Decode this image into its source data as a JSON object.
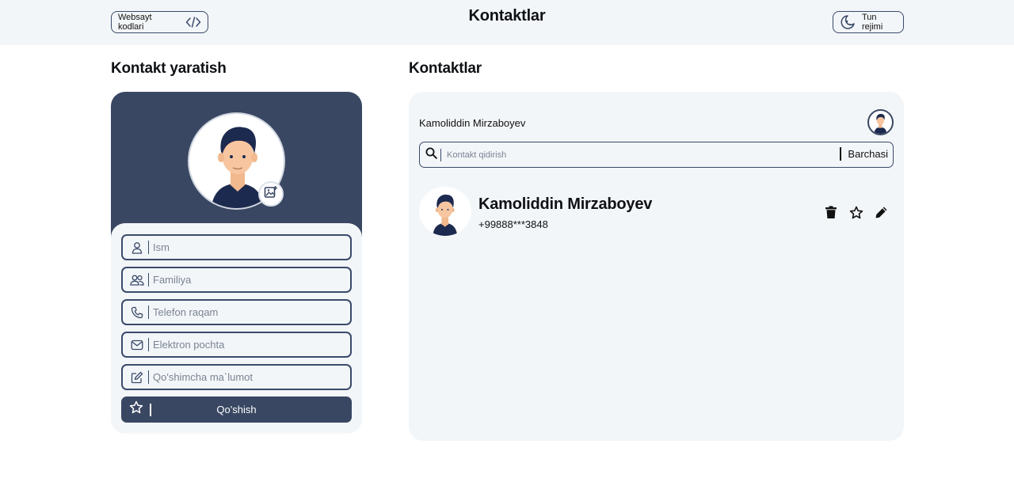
{
  "header": {
    "code_button_label": "Websayt kodlari",
    "title": "Kontaktlar",
    "theme_button_label": "Tun rejimi"
  },
  "create": {
    "title": "Kontakt yaratish",
    "fields": {
      "first_name_placeholder": "Ism",
      "last_name_placeholder": "Familiya",
      "phone_placeholder": "Telefon raqam",
      "email_placeholder": "Elektron pochta",
      "note_placeholder": "Qo'shimcha ma`lumot"
    },
    "submit_label": "Qo'shish"
  },
  "contacts": {
    "title": "Kontaktlar",
    "current_user": "Kamoliddin Mirzaboyev",
    "search_placeholder": "Kontakt qidirish",
    "filter_label": "Barchasi",
    "items": [
      {
        "name": "Kamoliddin Mirzaboyev",
        "phone": "+99888***3848"
      }
    ]
  },
  "colors": {
    "accent": "#394763",
    "surface": "#f3f6f8"
  },
  "icons": [
    "code-icon",
    "moon-icon",
    "image-add-icon",
    "user-icon",
    "users-icon",
    "phone-icon",
    "mail-icon",
    "edit-note-icon",
    "star-icon",
    "search-icon",
    "trash-icon",
    "pencil-icon"
  ]
}
